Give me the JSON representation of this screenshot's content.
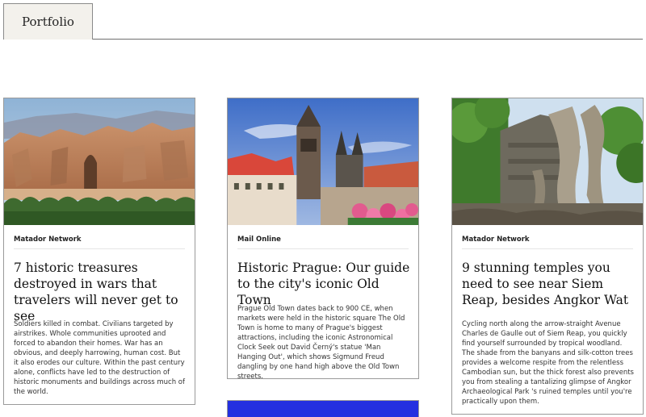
{
  "header": {
    "tab_label": "Portfolio"
  },
  "cards": [
    {
      "source": "Matador Network",
      "title": "7 historic treasures destroyed in wars that travelers will never get to see",
      "description": "Soldiers killed in combat. Civilians targeted by airstrikes. Whole communities uprooted and forced to abandon their homes. War has an obvious, and deeply harrowing, human cost. But it also erodes our culture. Within the past century alone, conflicts have led to the destruction of historic monuments and buildings across much of the world."
    },
    {
      "source": "Mail Online",
      "title": "Historic Prague: Our guide to the city's iconic Old Town",
      "description": "Prague Old Town dates back to 900 CE, when markets were held in the historic square The Old Town is home to many of Prague's biggest attractions, including the iconic Astronomical Clock Seek out David Černý's statue 'Man Hanging Out', which shows Sigmund Freud dangling by one hand high above the Old Town streets."
    },
    {
      "source": "Matador Network",
      "title": "9 stunning temples you need to see near Siem Reap, besides Angkor Wat",
      "description": "Cycling north along the arrow-straight Avenue Charles de Gaulle out of Siem Reap, you quickly find yourself surrounded by tropical woodland. The shade from the banyans and silk-cotton trees provides a welcome respite from the relentless Cambodian sun, but the thick forest also prevents you from stealing a tantalizing glimpse of Angkor Archaeological Park 's ruined temples until you're practically upon them."
    }
  ],
  "colors": {
    "partial_card": "#2430e0",
    "tab_bg": "#f3f1ec"
  }
}
